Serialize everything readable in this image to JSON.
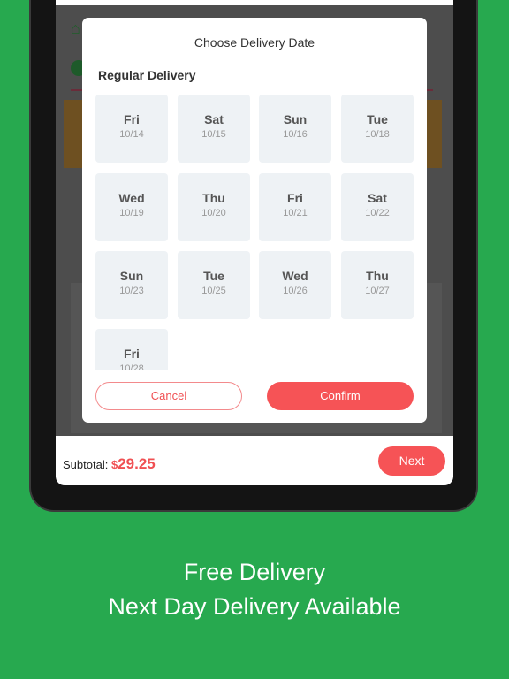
{
  "modal": {
    "title": "Choose Delivery Date",
    "section": "Regular Delivery",
    "dates": [
      {
        "day": "Fri",
        "date": "10/14"
      },
      {
        "day": "Sat",
        "date": "10/15"
      },
      {
        "day": "Sun",
        "date": "10/16"
      },
      {
        "day": "Tue",
        "date": "10/18"
      },
      {
        "day": "Wed",
        "date": "10/19"
      },
      {
        "day": "Thu",
        "date": "10/20"
      },
      {
        "day": "Fri",
        "date": "10/21"
      },
      {
        "day": "Sat",
        "date": "10/22"
      },
      {
        "day": "Sun",
        "date": "10/23"
      },
      {
        "day": "Tue",
        "date": "10/25"
      },
      {
        "day": "Wed",
        "date": "10/26"
      },
      {
        "day": "Thu",
        "date": "10/27"
      },
      {
        "day": "Fri",
        "date": "10/28"
      }
    ],
    "cancel": "Cancel",
    "confirm": "Confirm"
  },
  "bottom": {
    "subtotal_label": "Subtotal:",
    "currency": "$",
    "amount": "29.25",
    "next": "Next"
  },
  "promo": {
    "line1": "Free Delivery",
    "line2": "Next Day Delivery Available"
  },
  "colors": {
    "accent": "#f65356",
    "background": "#27a94f"
  }
}
